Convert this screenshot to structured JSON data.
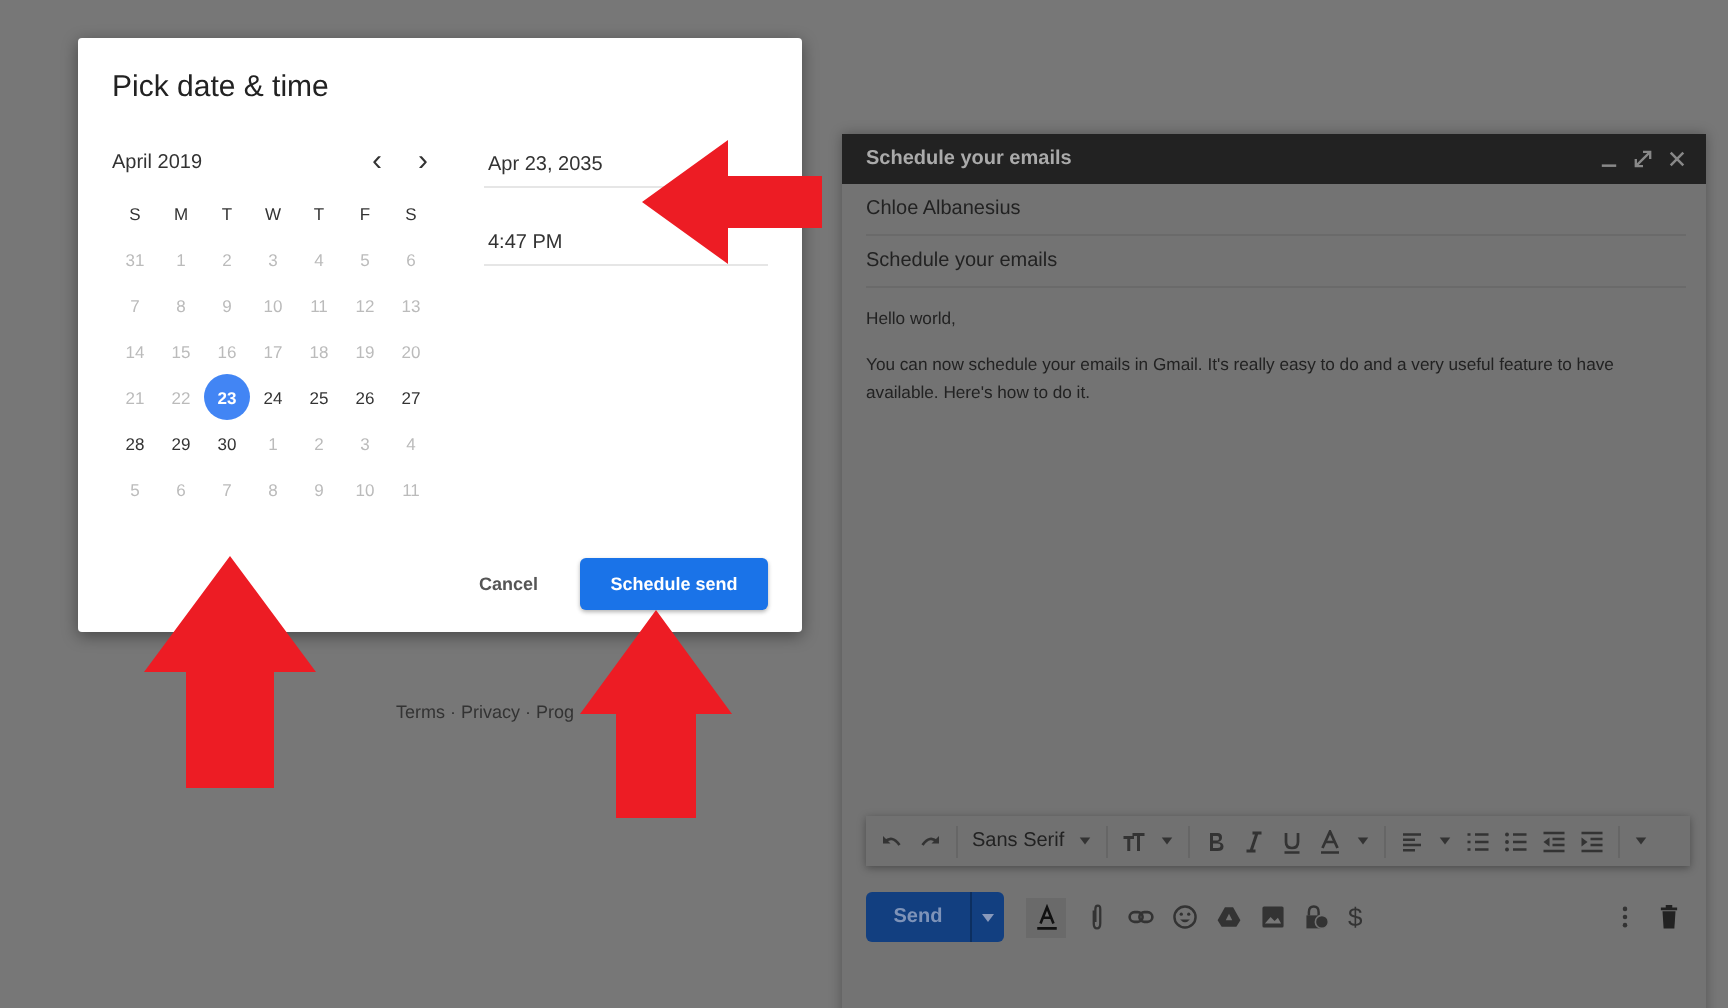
{
  "dialog": {
    "title": "Pick date & time",
    "month": "April 2019",
    "prev": "‹",
    "next": "›",
    "weekdays": [
      "S",
      "M",
      "T",
      "W",
      "T",
      "F",
      "S"
    ],
    "weeks": [
      [
        {
          "day": "31",
          "muted": true,
          "selected": false
        },
        {
          "day": "1",
          "muted": true,
          "selected": false
        },
        {
          "day": "2",
          "muted": true,
          "selected": false
        },
        {
          "day": "3",
          "muted": true,
          "selected": false
        },
        {
          "day": "4",
          "muted": true,
          "selected": false
        },
        {
          "day": "5",
          "muted": true,
          "selected": false
        },
        {
          "day": "6",
          "muted": true,
          "selected": false
        }
      ],
      [
        {
          "day": "7",
          "muted": true,
          "selected": false
        },
        {
          "day": "8",
          "muted": true,
          "selected": false
        },
        {
          "day": "9",
          "muted": true,
          "selected": false
        },
        {
          "day": "10",
          "muted": true,
          "selected": false
        },
        {
          "day": "11",
          "muted": true,
          "selected": false
        },
        {
          "day": "12",
          "muted": true,
          "selected": false
        },
        {
          "day": "13",
          "muted": true,
          "selected": false
        }
      ],
      [
        {
          "day": "14",
          "muted": true,
          "selected": false
        },
        {
          "day": "15",
          "muted": true,
          "selected": false
        },
        {
          "day": "16",
          "muted": true,
          "selected": false
        },
        {
          "day": "17",
          "muted": true,
          "selected": false
        },
        {
          "day": "18",
          "muted": true,
          "selected": false
        },
        {
          "day": "19",
          "muted": true,
          "selected": false
        },
        {
          "day": "20",
          "muted": true,
          "selected": false
        }
      ],
      [
        {
          "day": "21",
          "muted": true,
          "selected": false
        },
        {
          "day": "22",
          "muted": true,
          "selected": false
        },
        {
          "day": "23",
          "muted": false,
          "selected": true
        },
        {
          "day": "24",
          "muted": false,
          "selected": false
        },
        {
          "day": "25",
          "muted": false,
          "selected": false
        },
        {
          "day": "26",
          "muted": false,
          "selected": false
        },
        {
          "day": "27",
          "muted": false,
          "selected": false
        }
      ],
      [
        {
          "day": "28",
          "muted": false,
          "selected": false
        },
        {
          "day": "29",
          "muted": false,
          "selected": false
        },
        {
          "day": "30",
          "muted": false,
          "selected": false
        },
        {
          "day": "1",
          "muted": true,
          "selected": false
        },
        {
          "day": "2",
          "muted": true,
          "selected": false
        },
        {
          "day": "3",
          "muted": true,
          "selected": false
        },
        {
          "day": "4",
          "muted": true,
          "selected": false
        }
      ],
      [
        {
          "day": "5",
          "muted": true,
          "selected": false
        },
        {
          "day": "6",
          "muted": true,
          "selected": false
        },
        {
          "day": "7",
          "muted": true,
          "selected": false
        },
        {
          "day": "8",
          "muted": true,
          "selected": false
        },
        {
          "day": "9",
          "muted": true,
          "selected": false
        },
        {
          "day": "10",
          "muted": true,
          "selected": false
        },
        {
          "day": "11",
          "muted": true,
          "selected": false
        }
      ]
    ],
    "date_value": "Apr 23, 2035",
    "time_value": "4:47 PM",
    "buttons": [
      "Cancel",
      "Schedule send"
    ]
  },
  "footer": "Terms · Privacy · Prog",
  "compose": {
    "title": "Schedule your emails",
    "to": "Chloe Albanesius",
    "subject": "Schedule your emails",
    "body": [
      "Hello world,",
      "You can now schedule your emails in Gmail. It's really easy to do and a very useful feature to have available. Here's how to do it."
    ],
    "font": "Sans Serif",
    "send": "Send",
    "money": "$"
  }
}
